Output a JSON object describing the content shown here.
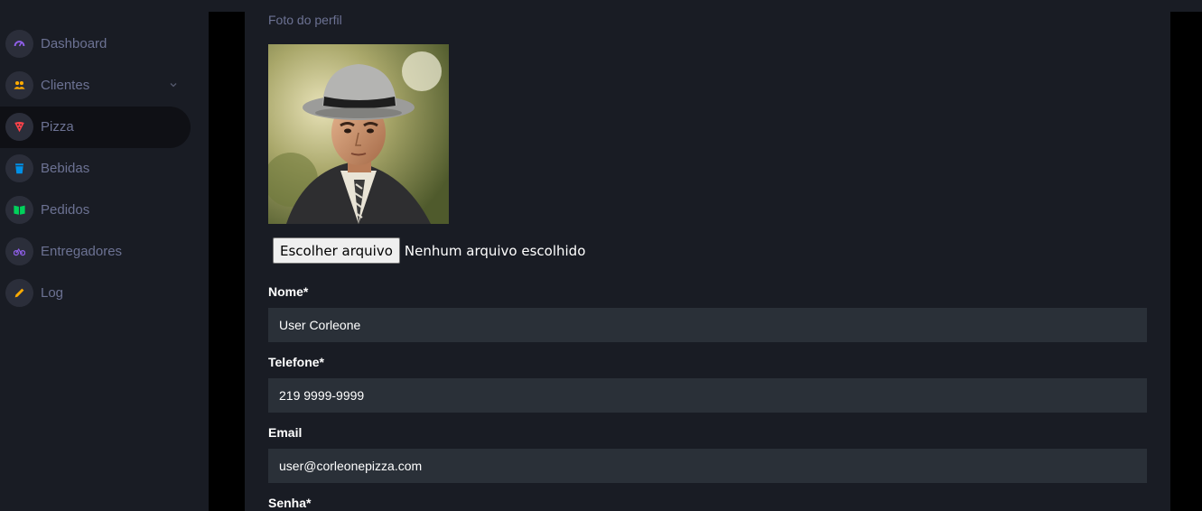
{
  "sidebar": {
    "items": [
      {
        "label": "Dashboard",
        "icon": "speedometer-icon",
        "color": "#8f5fe8"
      },
      {
        "label": "Clientes",
        "icon": "users-icon",
        "color": "#ffab00"
      },
      {
        "label": "Pizza",
        "icon": "pizza-icon",
        "color": "#fc424a"
      },
      {
        "label": "Bebidas",
        "icon": "cup-icon",
        "color": "#0090e7"
      },
      {
        "label": "Pedidos",
        "icon": "book-icon",
        "color": "#00d25b"
      },
      {
        "label": "Entregadores",
        "icon": "bike-icon",
        "color": "#8f5fe8"
      },
      {
        "label": "Log",
        "icon": "pencil-icon",
        "color": "#ffab00"
      }
    ],
    "active_item": "Pizza"
  },
  "form": {
    "photo_label": "Foto do perfil",
    "file_button_label": "Escolher arquivo",
    "file_status": "Nenhum arquivo escolhido",
    "nome": {
      "label": "Nome*",
      "value": "User Corleone"
    },
    "telefone": {
      "label": "Telefone*",
      "value": "219 9999-9999"
    },
    "email": {
      "label": "Email",
      "value": "user@corleonepizza.com"
    },
    "senha": {
      "label": "Senha*"
    }
  }
}
